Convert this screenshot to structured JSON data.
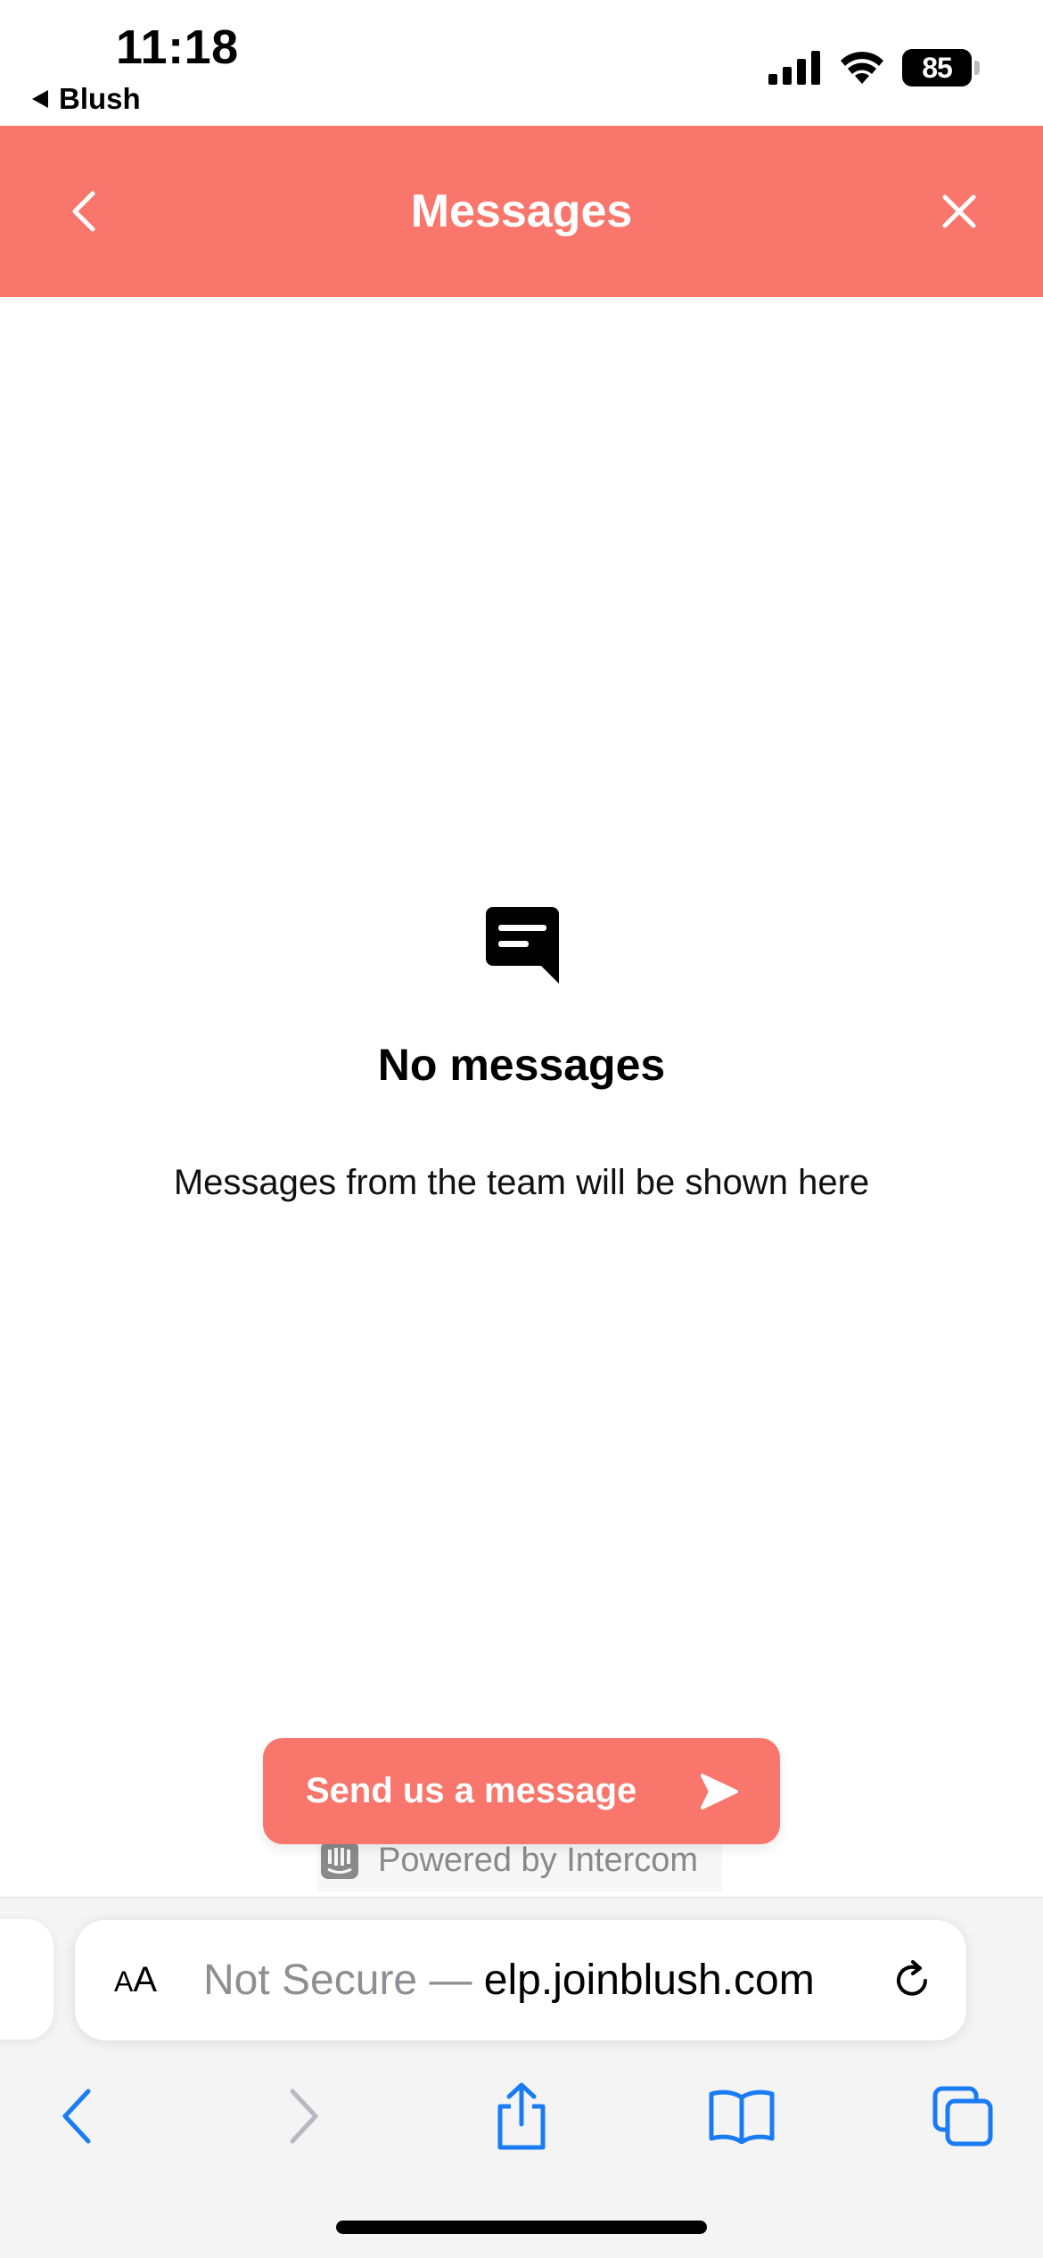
{
  "status_bar": {
    "time": "11:18",
    "back_app": "Blush",
    "battery": "85",
    "icons": [
      "cellular-signal-icon",
      "wifi-icon",
      "battery-icon"
    ]
  },
  "header": {
    "title": "Messages",
    "back_icon": "chevron-left-icon",
    "close_icon": "close-icon",
    "color": "#f8766b"
  },
  "empty_state": {
    "icon": "message-bubble-icon",
    "title": "No messages",
    "subtitle": "Messages from the team will be shown here"
  },
  "send_button": {
    "label": "Send us a message",
    "icon": "send-arrow-icon"
  },
  "powered_by": {
    "text": "Powered by Intercom",
    "icon": "intercom-logo-icon"
  },
  "safari": {
    "aa_label_small": "A",
    "aa_label_large": "A",
    "url_prefix": "Not Secure — ",
    "url_host": "elp.joinblush.com",
    "reload_icon": "reload-icon",
    "toolbar": [
      "back-icon",
      "forward-icon",
      "share-icon",
      "bookmarks-icon",
      "tabs-icon"
    ],
    "accent": "#1a7cf5"
  }
}
